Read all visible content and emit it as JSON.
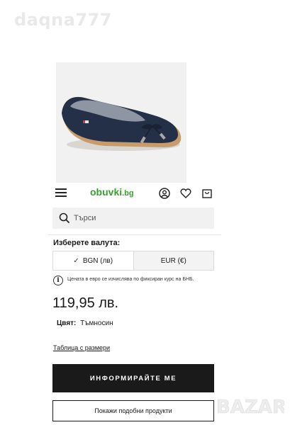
{
  "watermark": "daqna777",
  "header": {
    "logo_main": "obuvki",
    "logo_suffix": ".bg",
    "logo_color": "#38a12e"
  },
  "search": {
    "placeholder": "Търси"
  },
  "currency": {
    "title": "Изберете валута:",
    "options": [
      {
        "label": "BGN (лв)",
        "selected": true
      },
      {
        "label": "EUR (€)",
        "selected": false
      }
    ],
    "check_glyph": "✓",
    "info_glyph": "i",
    "info_text": "Цената в евро се изчислява по фиксиран курс на БНБ."
  },
  "product": {
    "price": "119,95 лв.",
    "color_label": "Цвят:",
    "color_value": "Тъмносин",
    "size_table": "Таблица с размери"
  },
  "buttons": {
    "notify": "ИНФОРМИРАЙТЕ МЕ",
    "similar": "Покажи подобни продукти"
  },
  "badge": "BAZAR",
  "icons": [
    "hamburger-menu-icon",
    "user-icon",
    "heart-icon",
    "bag-icon",
    "search-icon",
    "check-icon",
    "info-icon"
  ],
  "colors": {
    "button_dark": "#1a1a1a",
    "shoe": "#243047"
  }
}
